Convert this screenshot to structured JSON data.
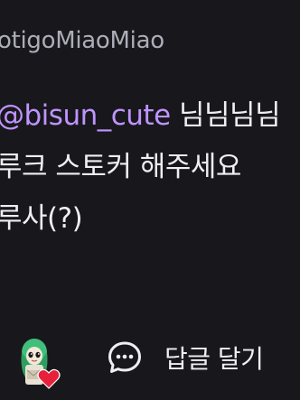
{
  "comment": {
    "username": "otigoMiaoMiao",
    "mention": "@bisun_cute",
    "line1_text": " 님님님님",
    "line2": "루크 스토커 해주세요",
    "line3": "루사(?)"
  },
  "footer": {
    "sticker_icon": "ghost-heart-sticker-icon",
    "reply_icon": "chat-bubble-icon",
    "reply_label": "답글 달기"
  },
  "colors": {
    "background": "#18171c",
    "mention": "#bf94ff",
    "username": "#adadb8",
    "text": "#efeff1"
  }
}
